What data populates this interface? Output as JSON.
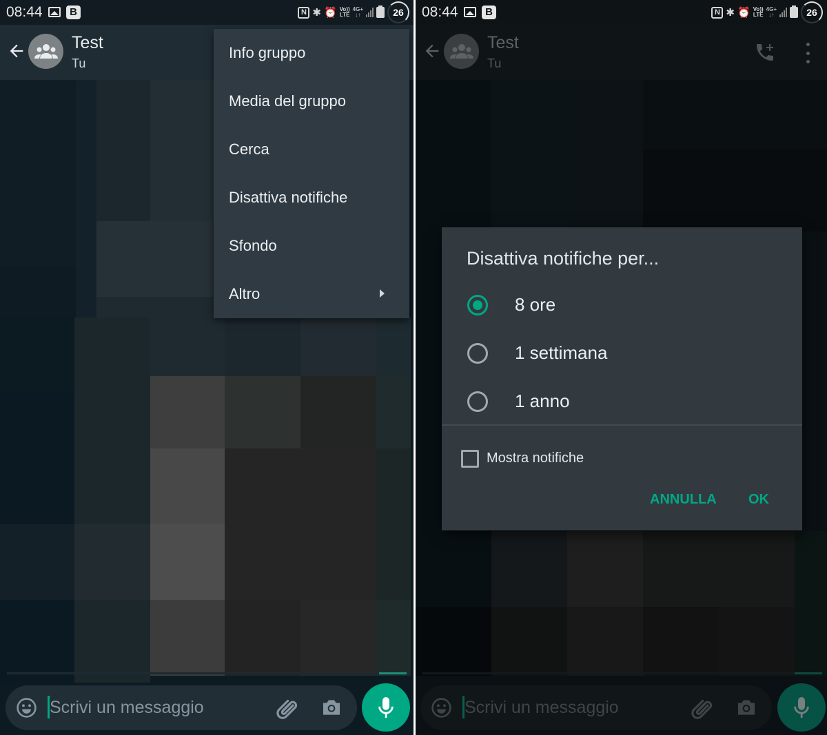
{
  "status_bar": {
    "time": "08:44",
    "b_badge": "B",
    "network_label_top": "Vo)) ",
    "network_label_bottom": "LTE",
    "data_label_top": "4G+",
    "data_label_bottom": "↓↑",
    "nfc_label": "N",
    "bluetooth_glyph": "✱",
    "alarm_glyph": "⏰",
    "battery_level": "26",
    "icons": [
      "gallery-icon",
      "b-badge-icon",
      "nfc-icon",
      "bluetooth-icon",
      "alarm-icon",
      "volte-icon",
      "4g-plus-icon",
      "signal-icon",
      "battery-icon"
    ]
  },
  "left_screen": {
    "header": {
      "title": "Test",
      "subtitle": "Tu"
    },
    "menu": {
      "items": [
        {
          "label": "Info gruppo"
        },
        {
          "label": "Media del gruppo"
        },
        {
          "label": "Cerca"
        },
        {
          "label": "Disattiva notifiche"
        },
        {
          "label": "Sfondo"
        },
        {
          "label": "Altro",
          "has_submenu": true
        }
      ]
    },
    "composer": {
      "placeholder": "Scrivi un messaggio",
      "value": ""
    }
  },
  "right_screen": {
    "header": {
      "title": "Test",
      "subtitle": "Tu"
    },
    "dialog": {
      "title": "Disattiva notifiche per...",
      "options": [
        {
          "label": "8 ore",
          "selected": true
        },
        {
          "label": "1 settimana",
          "selected": false
        },
        {
          "label": "1 anno",
          "selected": false
        }
      ],
      "checkbox": {
        "label": "Mostra notifiche",
        "checked": false
      },
      "cancel_label": "ANNULLA",
      "ok_label": "OK"
    },
    "composer": {
      "placeholder": "Scrivi un messaggio",
      "value": ""
    }
  },
  "colors": {
    "accent": "#00a884",
    "menu_bg": "#2f3a42",
    "dialog_bg": "#323a40",
    "header_bg": "#1f2c34"
  }
}
